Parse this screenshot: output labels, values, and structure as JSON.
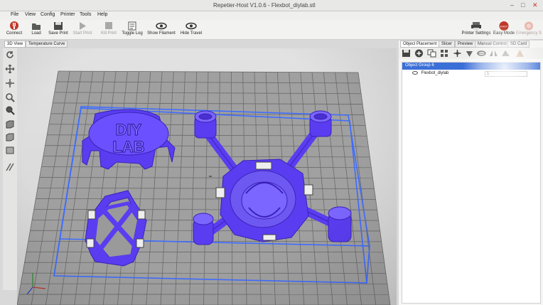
{
  "window": {
    "title": "Repetier-Host V1.0.6 - Flexbot_diylab.stl"
  },
  "menu": [
    "File",
    "View",
    "Config",
    "Printer",
    "Tools",
    "Help"
  ],
  "toolbar": {
    "connect": "Connect",
    "load": "Load",
    "save_print": "Save Print",
    "start_print": "Start Print",
    "kill_print": "Kill Print",
    "toggle_log": "Toggle Log",
    "show_filament": "Show Filament",
    "hide_travel": "Hide Travel",
    "printer_settings": "Printer Settings",
    "easy_mode": "Easy Mode",
    "emergency_stop": "Emergency St"
  },
  "left_tabs": [
    "3D View",
    "Temperature Curve"
  ],
  "right_tabs": [
    "Object Placement",
    "Slicer",
    "Preview",
    "Manual Control",
    "SD Card"
  ],
  "object_tree": {
    "group": "Object Group 6",
    "item": "Flexbot_diylab",
    "item_value": "1"
  },
  "model": {
    "lid_text_line1": "DIY",
    "lid_text_line2": "LAB"
  },
  "colors": {
    "model": "#5a3df0",
    "bed_box": "#3f6cff",
    "grid": "#6a6a6a",
    "bed": "#9b9b9b",
    "selection": "#3b6fd8"
  }
}
